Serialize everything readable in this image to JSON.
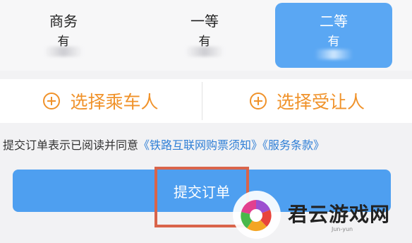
{
  "seat_tabs": [
    {
      "name": "商务",
      "availability": "有"
    },
    {
      "name": "一等",
      "availability": "有"
    },
    {
      "name": "二等",
      "availability": "有"
    }
  ],
  "actions": {
    "select_passenger": "选择乘车人",
    "select_transferee": "选择受让人"
  },
  "agreement": {
    "prefix": "提交订单表示已阅读并同意",
    "link_rail": "《铁路互联网购票须知》",
    "link_terms": "《服务条款》"
  },
  "submit_label": "提交订单",
  "watermark": {
    "text": "君云游戏网",
    "sub": "Jun-yun"
  },
  "colors": {
    "accent_blue": "#4e9ff0",
    "selected_tab": "#5aa7f3",
    "orange": "#f0922a",
    "highlight": "#d9644a",
    "link": "#2f7fd6"
  }
}
